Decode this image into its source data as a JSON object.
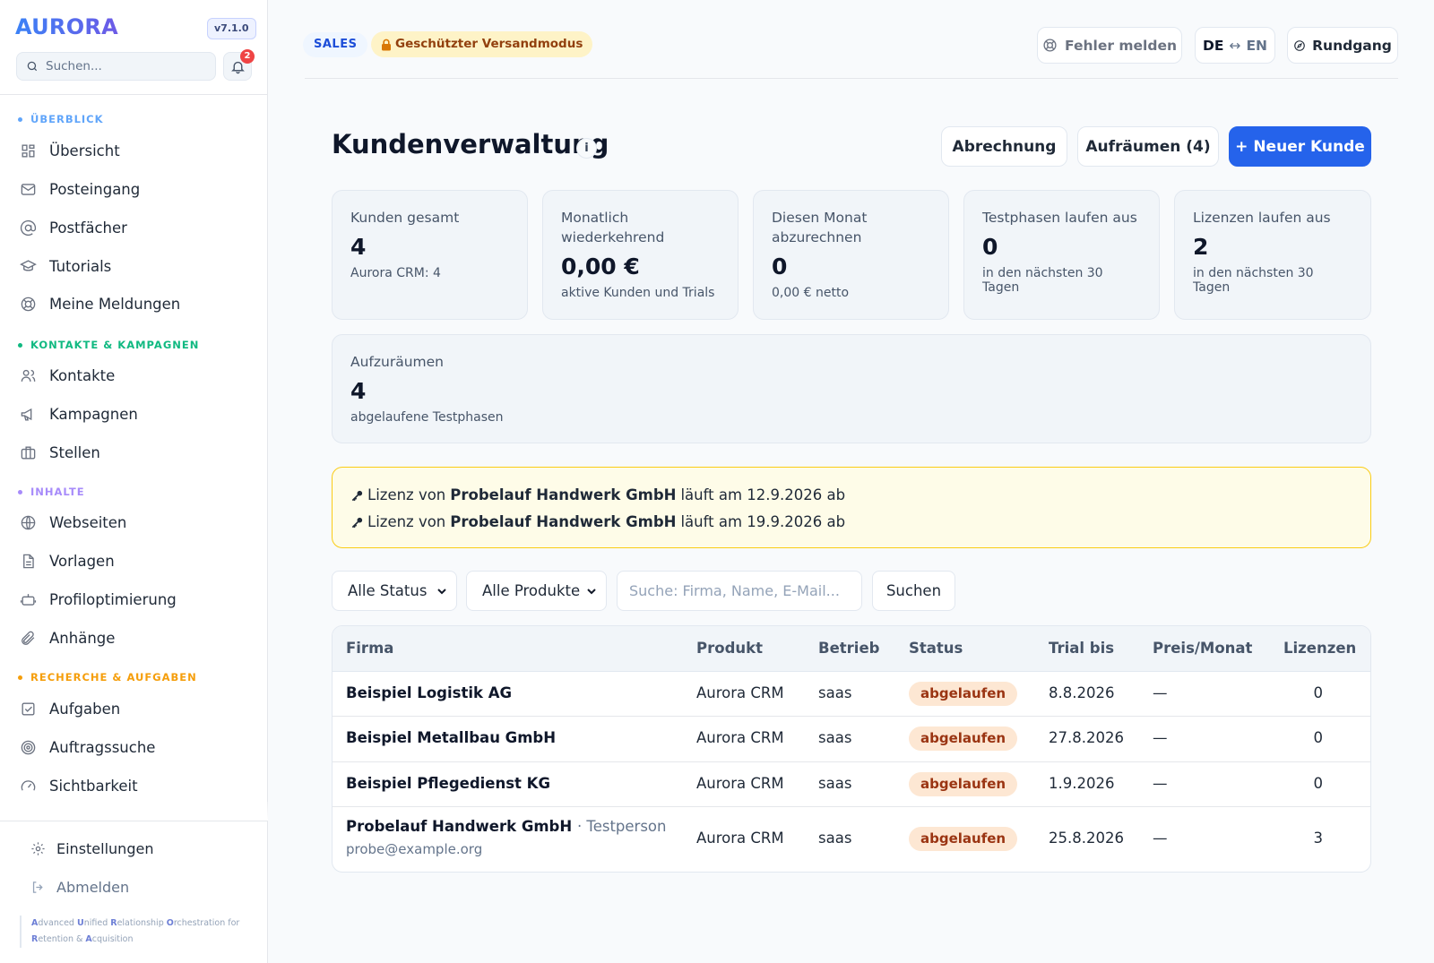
{
  "sidebar": {
    "brand": "AURORA",
    "version": "v7.1.0",
    "search_placeholder": "Suchen...",
    "notification_count": "2",
    "sections": [
      {
        "label": "ÜBERBLICK",
        "color": "#60a5fa"
      },
      {
        "label": "KONTAKTE & KAMPAGNEN",
        "color": "#10b981"
      },
      {
        "label": "INHALTE",
        "color": "#a78bfa"
      },
      {
        "label": "RECHERCHE & AUFGABEN",
        "color": "#f59e0b"
      }
    ],
    "items": [
      {
        "label": "Übersicht",
        "icon": "grid-icon"
      },
      {
        "label": "Posteingang",
        "icon": "mail-icon"
      },
      {
        "label": "Postfächer",
        "icon": "at-sign-icon"
      },
      {
        "label": "Tutorials",
        "icon": "graduation-cap-icon"
      },
      {
        "label": "Meine Meldungen",
        "icon": "lifebuoy-icon"
      },
      {
        "label": "Kontakte",
        "icon": "users-icon"
      },
      {
        "label": "Kampagnen",
        "icon": "megaphone-icon"
      },
      {
        "label": "Stellen",
        "icon": "briefcase-icon"
      },
      {
        "label": "Webseiten",
        "icon": "globe-icon"
      },
      {
        "label": "Vorlagen",
        "icon": "document-icon"
      },
      {
        "label": "Profiloptimierung",
        "icon": "bot-icon"
      },
      {
        "label": "Anhänge",
        "icon": "paperclip-icon"
      },
      {
        "label": "Aufgaben",
        "icon": "check-square-icon"
      },
      {
        "label": "Auftragssuche",
        "icon": "target-icon"
      },
      {
        "label": "Sichtbarkeit",
        "icon": "gauge-icon"
      }
    ],
    "settings_label": "Einstellungen",
    "logout_label": "Abmelden",
    "tagline": [
      {
        "initial": "A",
        "rest": "dvanced "
      },
      {
        "initial": "U",
        "rest": "nified "
      },
      {
        "initial": "R",
        "rest": "elationship "
      },
      {
        "initial": "O",
        "rest": "rchestration for "
      },
      {
        "initial": "R",
        "rest": "etention & "
      },
      {
        "initial": "A",
        "rest": "cquisition"
      }
    ]
  },
  "topbar": {
    "sales_label": "SALES",
    "protected_label": "Geschützter Versandmodus",
    "report_label": "Fehler melden",
    "lang_from": "DE",
    "lang_arrow": "↔",
    "lang_to": "EN",
    "tour_label": "Rundgang"
  },
  "header": {
    "title": "Kundenverwaltung",
    "info": "i",
    "billing_label": "Abrechnung",
    "cleanup_label": "Aufräumen (4)",
    "new_customer_label": "+ Neuer Kunde"
  },
  "stats": [
    {
      "label": "Kunden gesamt",
      "value": "4",
      "sub": "Aurora CRM: 4"
    },
    {
      "label": "Monatlich wiederkehrend",
      "value": "0,00 €",
      "sub": "aktive Kunden und Trials"
    },
    {
      "label": "Diesen Monat abzurechnen",
      "value": "0",
      "sub": "0,00 € netto"
    },
    {
      "label": "Testphasen laufen aus",
      "value": "0",
      "sub": "in den nächsten 30 Tagen"
    },
    {
      "label": "Lizenzen laufen aus",
      "value": "2",
      "sub": "in den nächsten 30 Tagen"
    }
  ],
  "cleanup_card": {
    "label": "Aufzuräumen",
    "value": "4",
    "sub": "abgelaufene Testphasen"
  },
  "alerts": [
    {
      "prefix": "Lizenz von",
      "company": "Probelauf Handwerk GmbH",
      "suffix": "läuft am 12.9.2026 ab"
    },
    {
      "prefix": "Lizenz von",
      "company": "Probelauf Handwerk GmbH",
      "suffix": "läuft am 19.9.2026 ab"
    }
  ],
  "filters": {
    "status_selected": "Alle Status",
    "product_selected": "Alle Produkte",
    "search_placeholder": "Suche: Firma, Name, E-Mail...",
    "search_button": "Suchen"
  },
  "table": {
    "columns": [
      "Firma",
      "Produkt",
      "Betrieb",
      "Status",
      "Trial bis",
      "Preis/Monat",
      "Lizenzen"
    ],
    "rows": [
      {
        "firm": "Beispiel Logistik AG",
        "contact": "",
        "email": "",
        "product": "Aurora CRM",
        "mode": "saas",
        "status": "abgelaufen",
        "trial": "8.8.2026",
        "price": "—",
        "licenses": "0"
      },
      {
        "firm": "Beispiel Metallbau GmbH",
        "contact": "",
        "email": "",
        "product": "Aurora CRM",
        "mode": "saas",
        "status": "abgelaufen",
        "trial": "27.8.2026",
        "price": "—",
        "licenses": "0"
      },
      {
        "firm": "Beispiel Pflegedienst KG",
        "contact": "",
        "email": "",
        "product": "Aurora CRM",
        "mode": "saas",
        "status": "abgelaufen",
        "trial": "1.9.2026",
        "price": "—",
        "licenses": "0"
      },
      {
        "firm": "Probelauf Handwerk GmbH",
        "contact": "· Testperson",
        "email": "probe@example.org",
        "product": "Aurora CRM",
        "mode": "saas",
        "status": "abgelaufen",
        "trial": "25.8.2026",
        "price": "—",
        "licenses": "3"
      }
    ]
  }
}
